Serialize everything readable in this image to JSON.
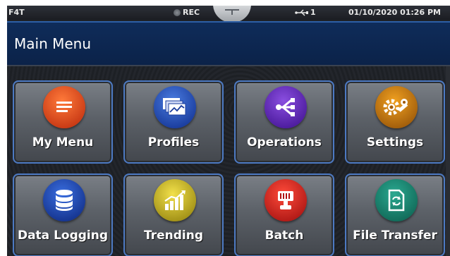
{
  "statusbar": {
    "brand": "F4T",
    "rec_label": "REC",
    "usb_count": "1",
    "datetime": "01/10/2020 01:26 PM"
  },
  "header": {
    "title": "Main Menu"
  },
  "menu": {
    "items": [
      {
        "label": "My Menu",
        "icon": "list-icon",
        "color": "#d9421a"
      },
      {
        "label": "Profiles",
        "icon": "profiles-icon",
        "color": "#1f4fc0"
      },
      {
        "label": "Operations",
        "icon": "share-icon",
        "color": "#5a22b8"
      },
      {
        "label": "Settings",
        "icon": "gears-icon",
        "color": "#c07010"
      },
      {
        "label": "Data Logging",
        "icon": "database-icon",
        "color": "#1a45b0"
      },
      {
        "label": "Trending",
        "icon": "bar-chart-icon",
        "color": "#c8b020"
      },
      {
        "label": "Batch",
        "icon": "batch-icon",
        "color": "#d01e1e"
      },
      {
        "label": "File Transfer",
        "icon": "file-transfer-icon",
        "color": "#178070"
      }
    ]
  }
}
